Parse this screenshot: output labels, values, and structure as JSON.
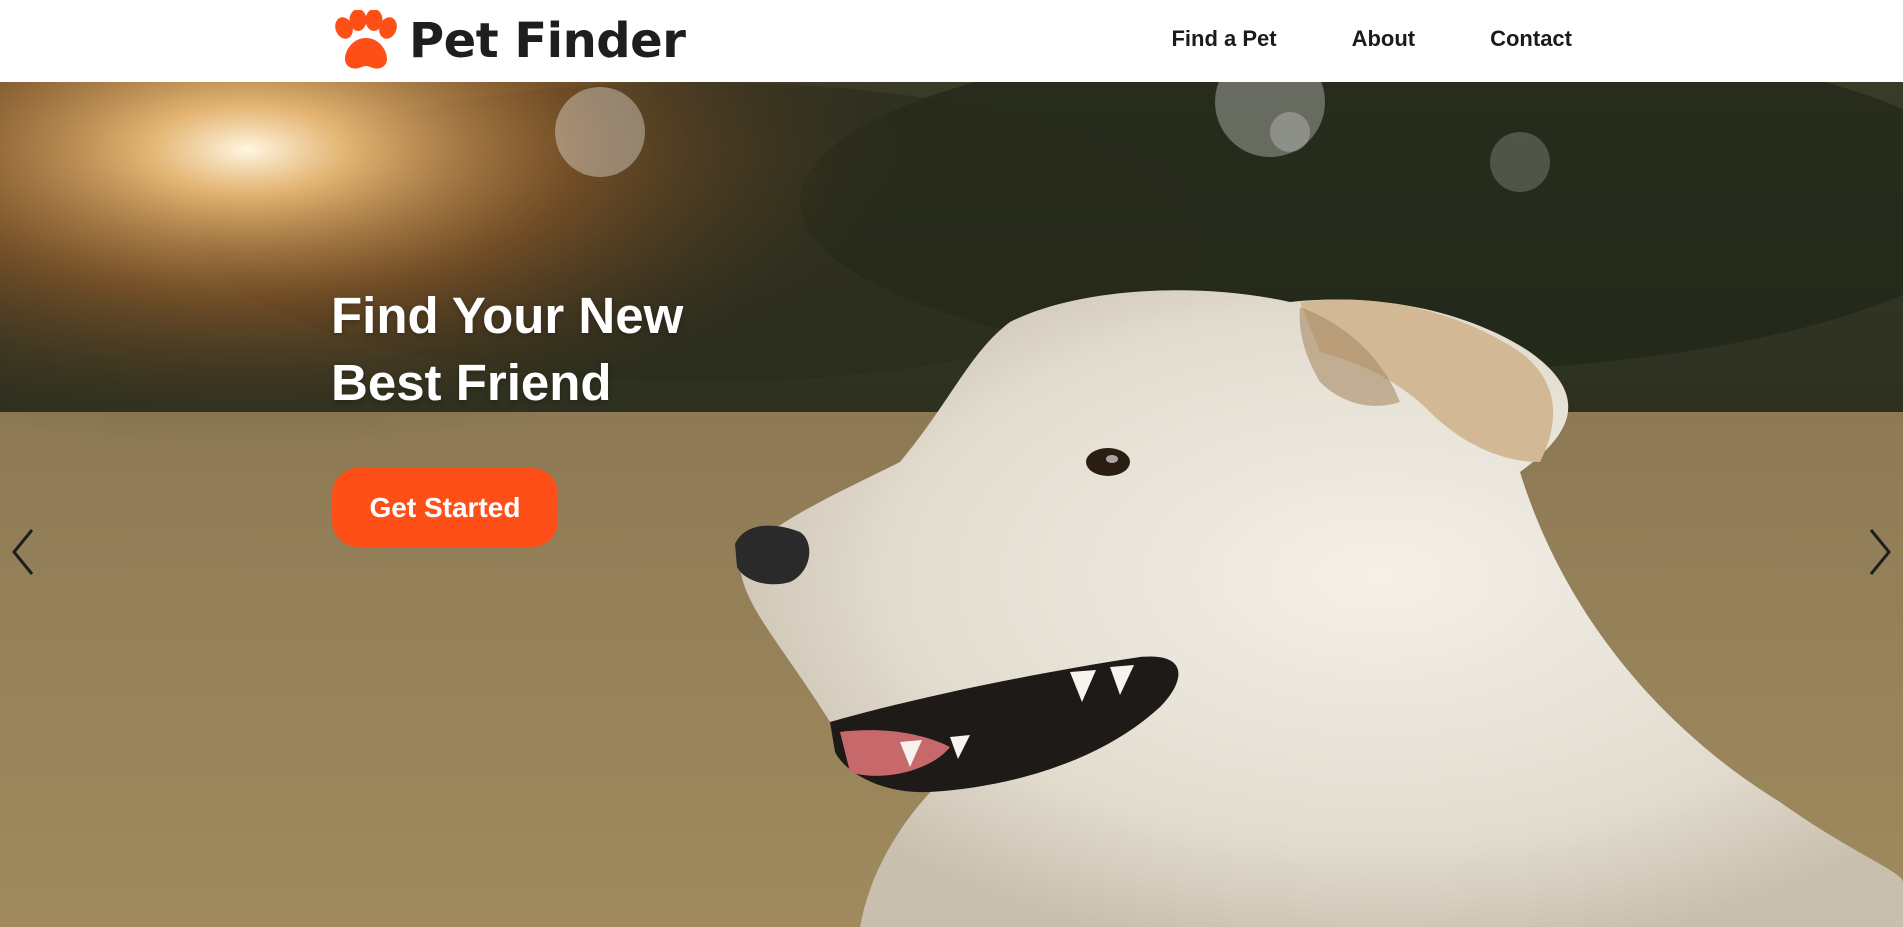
{
  "brand": {
    "name": "Pet Finder",
    "accent_color": "#ff4f18",
    "logo_icon": "paw-icon"
  },
  "nav": {
    "items": [
      {
        "label": "Find a Pet"
      },
      {
        "label": "About"
      },
      {
        "label": "Contact"
      }
    ]
  },
  "hero": {
    "title": "Find Your New Best Friend",
    "cta_label": "Get Started",
    "prev_icon": "chevron-left-icon",
    "next_icon": "chevron-right-icon",
    "image_subject": "white dog in sunlit field"
  }
}
